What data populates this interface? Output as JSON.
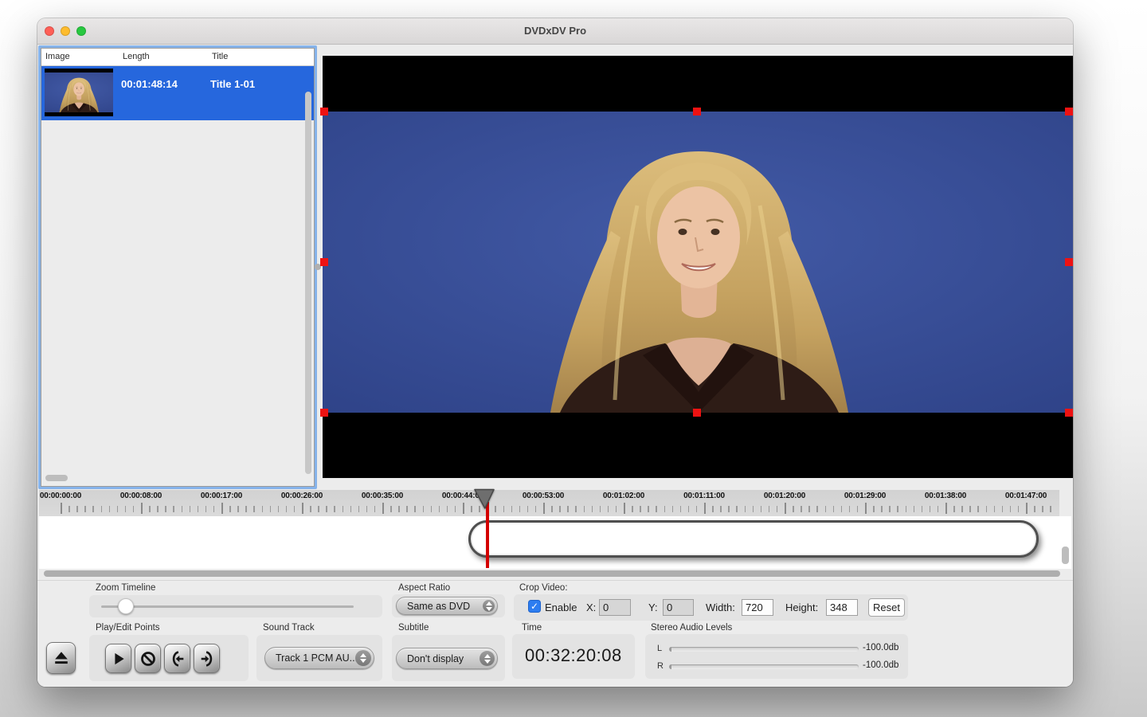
{
  "window": {
    "title": "DVDxDV Pro"
  },
  "list": {
    "columns": [
      "Image",
      "Length",
      "Title"
    ],
    "row": {
      "length": "00:01:48:14",
      "title": "Title 1-01"
    }
  },
  "timeline": {
    "ruler_labels": [
      "00:00:00:00",
      "00:00:08:00",
      "00:00:17:00",
      "00:00:26:00",
      "00:00:35:00",
      "00:00:44:00",
      "00:00:53:00",
      "00:01:02:00",
      "00:01:11:00",
      "00:01:20:00",
      "00:01:29:00",
      "00:01:38:00",
      "00:01:47:00"
    ]
  },
  "controls": {
    "zoom_timeline": {
      "label": "Zoom Timeline"
    },
    "play_edit": {
      "label": "Play/Edit Points"
    },
    "sound_track": {
      "label": "Sound Track",
      "value": "Track 1 PCM AU..."
    },
    "aspect_ratio": {
      "label": "Aspect Ratio",
      "value": "Same as DVD"
    },
    "subtitle": {
      "label": "Subtitle",
      "value": "Don't display"
    },
    "crop": {
      "label": "Crop Video:",
      "enable": "Enable",
      "x_label": "X:",
      "x_value": "0",
      "y_label": "Y:",
      "y_value": "0",
      "width_label": "Width:",
      "width_value": "720",
      "height_label": "Height:",
      "height_value": "348",
      "reset": "Reset",
      "check_glyph": "✓"
    },
    "time": {
      "label": "Time",
      "value": "00:32:20:08"
    },
    "audio": {
      "label": "Stereo Audio Levels",
      "left": "L",
      "right": "R",
      "left_value": "-100.0db",
      "right_value": "-100.0db"
    }
  },
  "colors": {
    "selection_blue": "#2667dd",
    "handle_red": "#ee1212",
    "playhead_red": "#d40000",
    "video_blue": "#3a53a0",
    "traffic_red": "#ff5f57",
    "traffic_yellow": "#febc2e",
    "traffic_green": "#28c840"
  }
}
